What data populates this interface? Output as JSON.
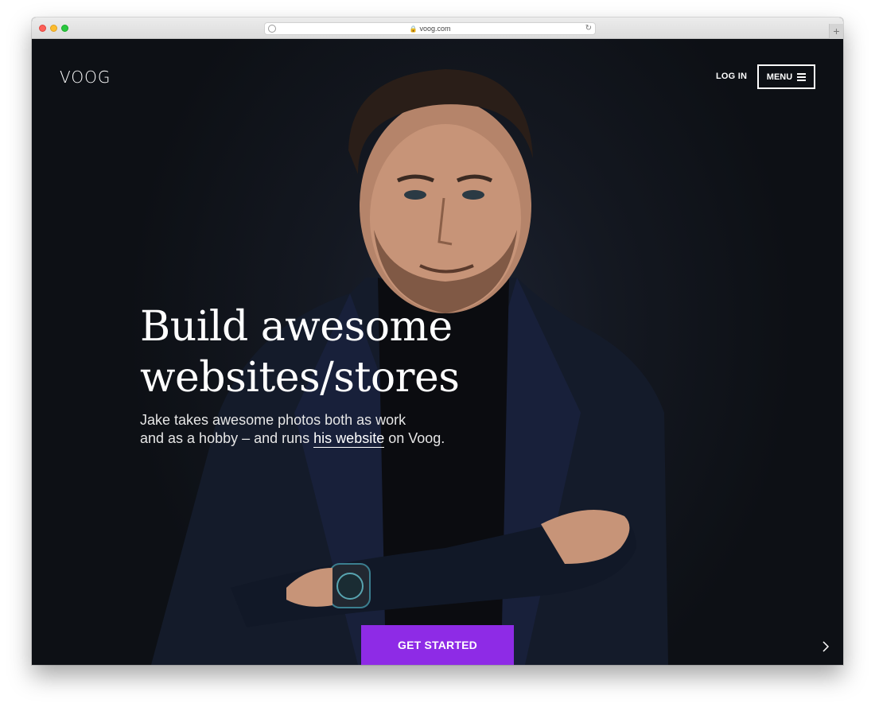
{
  "browser": {
    "url": "voog.com"
  },
  "nav": {
    "logo": "VOOG",
    "login_label": "LOG IN",
    "menu_label": "MENU"
  },
  "hero": {
    "headline_line1": "Build awesome",
    "headline_line2": "websites/stores",
    "sub_line1": "Jake takes awesome photos both as work",
    "sub_line2_pre": "and as a hobby – and runs ",
    "sub_link": "his website",
    "sub_line2_post": " on Voog.",
    "cta_label": "GET STARTED"
  },
  "colors": {
    "accent": "#8e2be6",
    "background": "#111418",
    "text": "#ffffff"
  },
  "icons": {
    "menu": "hamburger-icon",
    "next": "chevron-right-icon",
    "lock": "lock-icon",
    "reload": "reload-icon"
  }
}
